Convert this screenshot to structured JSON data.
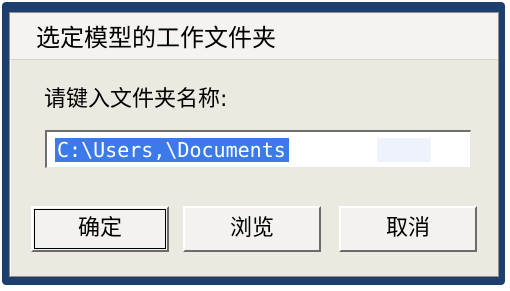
{
  "dialog": {
    "title": "选定模型的工作文件夹",
    "prompt": "请键入文件夹名称:",
    "path_value": "C:\\Users,\\Documents",
    "buttons": {
      "ok": "确定",
      "browse": "浏览",
      "cancel": "取消"
    }
  },
  "colors": {
    "frame": "#1d3f6e",
    "dialog_bg": "#ece9e1",
    "selection": "#3b7ae8"
  }
}
